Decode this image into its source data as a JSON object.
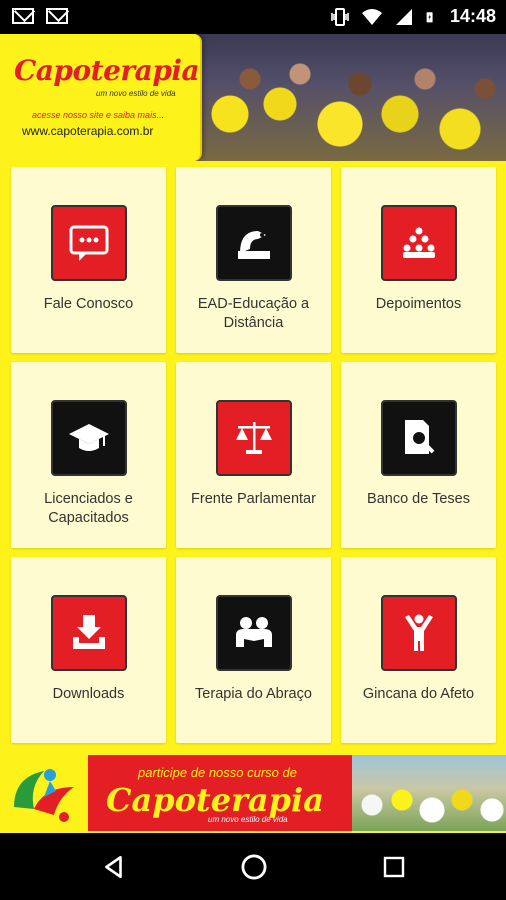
{
  "status_bar": {
    "time": "14:48",
    "notification_icons": [
      "gmail-icon",
      "gmail-icon"
    ],
    "system_icons": [
      "vibrate-icon",
      "wifi-icon",
      "signal-icon",
      "battery-charging-icon"
    ]
  },
  "header": {
    "logo": "Capoterapia",
    "tagline": "um novo estilo de vida",
    "subtitle": "acesse nosso site e saiba mais...",
    "url": "www.capoterapia.com.br"
  },
  "menu": [
    {
      "label": "Fale Conosco",
      "icon": "chat-icon",
      "color": "#e31e24"
    },
    {
      "label": "EAD-Educação a Distância",
      "icon": "education-icon",
      "color": "#111111"
    },
    {
      "label": "Depoimentos",
      "icon": "group-icon",
      "color": "#e31e24"
    },
    {
      "label": "Licenciados e Capacitados",
      "icon": "graduation-cap-icon",
      "color": "#111111"
    },
    {
      "label": "Frente Parlamentar",
      "icon": "scales-icon",
      "color": "#e31e24"
    },
    {
      "label": "Banco de Teses",
      "icon": "document-search-icon",
      "color": "#111111"
    },
    {
      "label": "Downloads",
      "icon": "download-icon",
      "color": "#e31e24"
    },
    {
      "label": "Terapia do Abraço",
      "icon": "hug-icon",
      "color": "#111111"
    },
    {
      "label": "Gincana do Afeto",
      "icon": "person-cheer-icon",
      "color": "#e31e24"
    }
  ],
  "bottom_banner": {
    "line1": "participe de nosso curso de",
    "logo": "Capoterapia",
    "tagline": "um novo estilo de vida"
  },
  "colors": {
    "brand_yellow": "#fdf31a",
    "brand_red": "#e31e24",
    "tile_bg": "#fefbd0"
  }
}
